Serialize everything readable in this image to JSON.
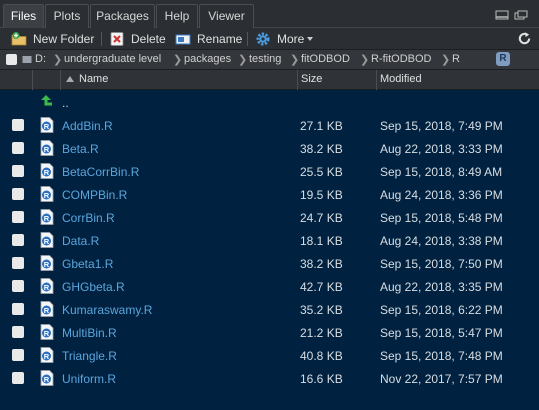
{
  "tabs": [
    "Files",
    "Plots",
    "Packages",
    "Help",
    "Viewer"
  ],
  "active_tab": "Files",
  "toolbar": {
    "new_folder": "New Folder",
    "delete": "Delete",
    "rename": "Rename",
    "more": "More"
  },
  "breadcrumb": {
    "items": [
      "D:",
      "undergraduate level",
      "packages",
      "testing",
      "fitODBOD",
      "R-fitODBOD",
      "R"
    ],
    "project_badge": "R"
  },
  "columns": {
    "name": "Name",
    "size": "Size",
    "modified": "Modified"
  },
  "up_label": "..",
  "files": [
    {
      "name": "AddBin.R",
      "size": "27.1 KB",
      "modified": "Sep 15, 2018, 7:49 PM"
    },
    {
      "name": "Beta.R",
      "size": "38.2 KB",
      "modified": "Aug 22, 2018, 3:33 PM"
    },
    {
      "name": "BetaCorrBin.R",
      "size": "25.5 KB",
      "modified": "Sep 15, 2018, 8:49 AM"
    },
    {
      "name": "COMPBin.R",
      "size": "19.5 KB",
      "modified": "Aug 24, 2018, 3:36 PM"
    },
    {
      "name": "CorrBin.R",
      "size": "24.7 KB",
      "modified": "Sep 15, 2018, 5:48 PM"
    },
    {
      "name": "Data.R",
      "size": "18.1 KB",
      "modified": "Aug 24, 2018, 3:38 PM"
    },
    {
      "name": "Gbeta1.R",
      "size": "38.2 KB",
      "modified": "Sep 15, 2018, 7:50 PM"
    },
    {
      "name": "GHGbeta.R",
      "size": "42.7 KB",
      "modified": "Aug 22, 2018, 3:35 PM"
    },
    {
      "name": "Kumaraswamy.R",
      "size": "35.2 KB",
      "modified": "Sep 15, 2018, 6:22 PM"
    },
    {
      "name": "MultiBin.R",
      "size": "21.2 KB",
      "modified": "Sep 15, 2018, 5:47 PM"
    },
    {
      "name": "Triangle.R",
      "size": "40.8 KB",
      "modified": "Sep 15, 2018, 7:48 PM"
    },
    {
      "name": "Uniform.R",
      "size": "16.6 KB",
      "modified": "Nov 22, 2017, 7:57 PM"
    }
  ],
  "colors": {
    "background": "#002240",
    "file_link": "#5ba5dc",
    "toolbar": "#2b2f33"
  }
}
